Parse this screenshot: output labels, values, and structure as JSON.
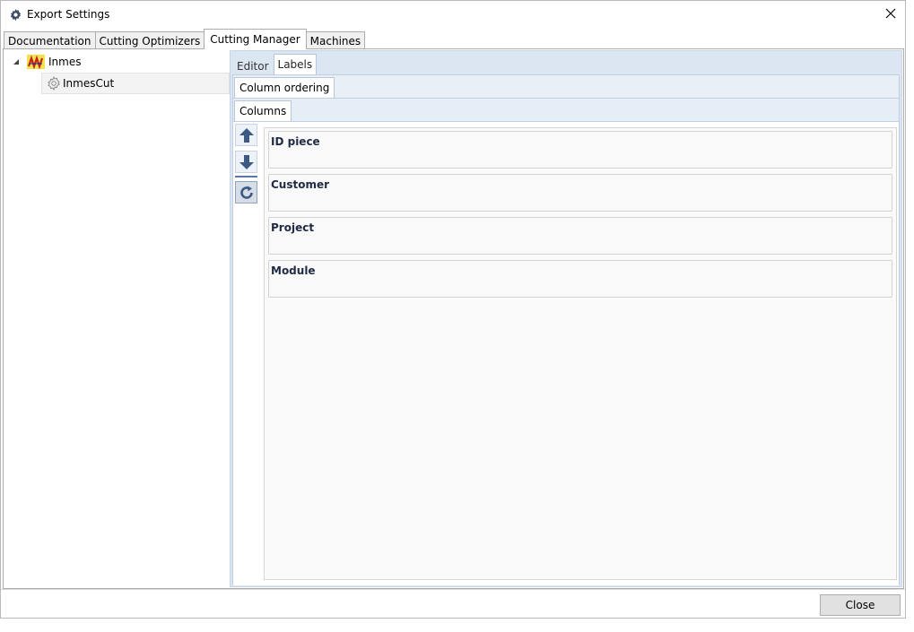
{
  "window": {
    "title": "Export Settings",
    "close_glyph": "✕"
  },
  "top_tabs": [
    "Documentation",
    "Cutting Optimizers",
    "Cutting Manager",
    "Machines"
  ],
  "top_tab_active": "Cutting Manager",
  "tree": {
    "root_label": "Inmes",
    "root_icon": "inmes-logo-icon",
    "child_label": "InmesCut",
    "child_icon": "gear-icon"
  },
  "editor_tabs": [
    "Editor",
    "Labels"
  ],
  "editor_tab_active": "Labels",
  "sub_tab": "Column ordering",
  "sub_sub_tab": "Columns",
  "columns": [
    "ID piece",
    "Customer",
    "Project",
    "Module"
  ],
  "buttons": {
    "close": "Close"
  },
  "colors": {
    "accent": "#dbe6f2",
    "arrow": "#3d5a85"
  }
}
